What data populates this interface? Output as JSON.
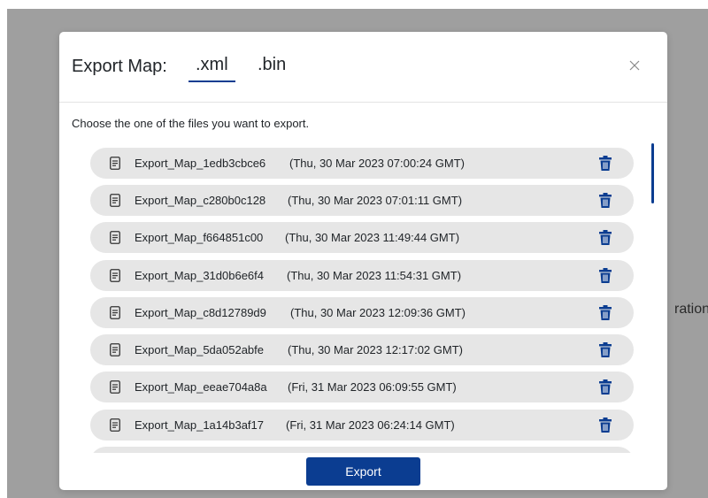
{
  "background": {
    "partial_text": "ration"
  },
  "modal": {
    "title": "Export Map:",
    "tabs": [
      {
        "label": ".xml",
        "active": true
      },
      {
        "label": ".bin",
        "active": false
      }
    ],
    "close_icon": "close-icon",
    "instruction": "Choose the one of the files you want to export.",
    "files": [
      {
        "name": "Export_Map_1edb3cbce6",
        "date": "(Thu, 30 Mar 2023 07:00:24 GMT)"
      },
      {
        "name": "Export_Map_c280b0c128",
        "date": "(Thu, 30 Mar 2023 07:01:11 GMT)"
      },
      {
        "name": "Export_Map_f664851c00",
        "date": "(Thu, 30 Mar 2023 11:49:44 GMT)"
      },
      {
        "name": "Export_Map_31d0b6e6f4",
        "date": "(Thu, 30 Mar 2023 11:54:31 GMT)"
      },
      {
        "name": "Export_Map_c8d12789d9",
        "date": "(Thu, 30 Mar 2023 12:09:36 GMT)"
      },
      {
        "name": "Export_Map_5da052abfe",
        "date": "(Thu, 30 Mar 2023 12:17:02 GMT)"
      },
      {
        "name": "Export_Map_eeae704a8a",
        "date": "(Fri, 31 Mar 2023 06:09:55 GMT)"
      },
      {
        "name": "Export_Map_1a14b3af17",
        "date": "(Fri, 31 Mar 2023 06:24:14 GMT)"
      }
    ],
    "export_label": "Export"
  },
  "colors": {
    "accent": "#0b3d91",
    "row_background": "#e6e6e6",
    "overlay": "#9f9f9f"
  },
  "icons": {
    "file": "file-text-icon",
    "delete": "trash-icon"
  }
}
